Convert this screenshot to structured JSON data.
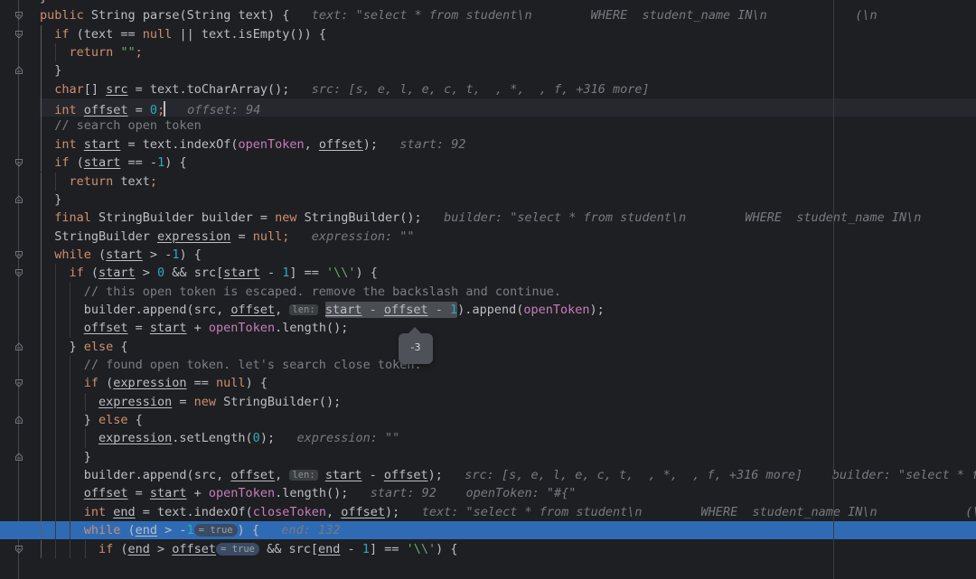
{
  "editor": {
    "file_language": "Java",
    "theme": "IntelliJ New Dark",
    "colors": {
      "background": "#1E1F22",
      "foreground": "#BCBEC4",
      "keyword": "#CF8E6D",
      "string": "#6AAB73",
      "number": "#2AACB8",
      "comment": "#7A7E85",
      "field": "#C77DBB",
      "inline_hint": "#767A80",
      "selection_line": "#2F6BB5",
      "caret_line": "#26282E",
      "tooltip_bg": "#4E5157"
    }
  },
  "tooltip": {
    "value": "-3",
    "evaluated_expression": "start - offset - 1"
  },
  "caret": {
    "line_index": 5,
    "column_text": "int offset = 0;"
  },
  "code_lines": [
    {
      "indent": 1,
      "fold": null,
      "tokens": [
        {
          "t": "}",
          "c": "sep"
        }
      ],
      "hints": [],
      "clipped_top": true
    },
    {
      "indent": 1,
      "fold": "start",
      "tokens": [
        {
          "t": "public ",
          "c": "kw"
        },
        {
          "t": "String ",
          "c": "typ"
        },
        {
          "t": "parse",
          "c": "mth"
        },
        {
          "t": "(",
          "c": "sep"
        },
        {
          "t": "String ",
          "c": "typ"
        },
        {
          "t": "text",
          "c": "var"
        },
        {
          "t": ") {",
          "c": "sep"
        }
      ],
      "hints": [
        {
          "text": "text: \"select * from student\\n        WHERE  student_name IN\\n            (\\n"
        }
      ]
    },
    {
      "indent": 2,
      "fold": "start",
      "tokens": [
        {
          "t": "if ",
          "c": "kw"
        },
        {
          "t": "(",
          "c": "sep"
        },
        {
          "t": "text",
          "c": "var"
        },
        {
          "t": " == ",
          "c": "op"
        },
        {
          "t": "null",
          "c": "kw"
        },
        {
          "t": " || ",
          "c": "op"
        },
        {
          "t": "text",
          "c": "var"
        },
        {
          "t": ".",
          "c": "sep"
        },
        {
          "t": "isEmpty",
          "c": "fn"
        },
        {
          "t": "()) {",
          "c": "sep"
        }
      ],
      "hints": []
    },
    {
      "indent": 3,
      "fold": null,
      "tokens": [
        {
          "t": "return ",
          "c": "kw"
        },
        {
          "t": "\"\"",
          "c": "str"
        },
        {
          "t": ";",
          "c": "semi"
        }
      ],
      "hints": []
    },
    {
      "indent": 2,
      "fold": "end",
      "tokens": [
        {
          "t": "}",
          "c": "sep"
        }
      ],
      "hints": []
    },
    {
      "indent": 2,
      "fold": null,
      "tokens": [
        {
          "t": "char",
          "c": "kw"
        },
        {
          "t": "[] ",
          "c": "sep"
        },
        {
          "t": "src",
          "c": "loc"
        },
        {
          "t": " = ",
          "c": "op"
        },
        {
          "t": "text",
          "c": "var"
        },
        {
          "t": ".",
          "c": "sep"
        },
        {
          "t": "toCharArray",
          "c": "fn"
        },
        {
          "t": "();",
          "c": "sep"
        }
      ],
      "hints": [
        {
          "text": "src: [s, e, l, e, c, t,  , *,  , f, +316 more]"
        }
      ]
    },
    {
      "indent": 2,
      "fold": null,
      "caret_line": true,
      "tokens": [
        {
          "t": "int ",
          "c": "kw"
        },
        {
          "t": "offset",
          "c": "loc"
        },
        {
          "t": " = ",
          "c": "op"
        },
        {
          "t": "0",
          "c": "num"
        },
        {
          "t": ";",
          "c": "semi"
        }
      ],
      "hints": [
        {
          "text": "offset: 94"
        }
      ]
    },
    {
      "indent": 2,
      "fold": null,
      "tokens": [
        {
          "t": "// search open token",
          "c": "cmt"
        }
      ],
      "hints": []
    },
    {
      "indent": 2,
      "fold": null,
      "tokens": [
        {
          "t": "int ",
          "c": "kw"
        },
        {
          "t": "start",
          "c": "loc"
        },
        {
          "t": " = ",
          "c": "op"
        },
        {
          "t": "text",
          "c": "var"
        },
        {
          "t": ".",
          "c": "sep"
        },
        {
          "t": "indexOf",
          "c": "fn"
        },
        {
          "t": "(",
          "c": "sep"
        },
        {
          "t": "openToken",
          "c": "fld"
        },
        {
          "t": ", ",
          "c": "sep"
        },
        {
          "t": "offset",
          "c": "loc"
        },
        {
          "t": ");",
          "c": "sep"
        }
      ],
      "hints": [
        {
          "text": "start: 92"
        }
      ]
    },
    {
      "indent": 2,
      "fold": "start",
      "tokens": [
        {
          "t": "if ",
          "c": "kw"
        },
        {
          "t": "(",
          "c": "sep"
        },
        {
          "t": "start",
          "c": "loc"
        },
        {
          "t": " == ",
          "c": "op"
        },
        {
          "t": "-",
          "c": "op"
        },
        {
          "t": "1",
          "c": "num"
        },
        {
          "t": ") {",
          "c": "sep"
        }
      ],
      "hints": []
    },
    {
      "indent": 3,
      "fold": null,
      "tokens": [
        {
          "t": "return ",
          "c": "kw"
        },
        {
          "t": "text",
          "c": "var"
        },
        {
          "t": ";",
          "c": "semi"
        }
      ],
      "hints": []
    },
    {
      "indent": 2,
      "fold": "end",
      "tokens": [
        {
          "t": "}",
          "c": "sep"
        }
      ],
      "hints": []
    },
    {
      "indent": 2,
      "fold": null,
      "tokens": [
        {
          "t": "final ",
          "c": "kw"
        },
        {
          "t": "StringBuilder ",
          "c": "typ"
        },
        {
          "t": "builder",
          "c": "var"
        },
        {
          "t": " = ",
          "c": "op"
        },
        {
          "t": "new ",
          "c": "kw"
        },
        {
          "t": "StringBuilder",
          "c": "typ"
        },
        {
          "t": "();",
          "c": "sep"
        }
      ],
      "hints": [
        {
          "text": "builder: \"select * from student\\n        WHERE  student_name IN\\n            ("
        }
      ]
    },
    {
      "indent": 2,
      "fold": null,
      "tokens": [
        {
          "t": "StringBuilder ",
          "c": "typ"
        },
        {
          "t": "expression",
          "c": "loc"
        },
        {
          "t": " = ",
          "c": "op"
        },
        {
          "t": "null",
          "c": "kw"
        },
        {
          "t": ";",
          "c": "semi"
        }
      ],
      "hints": [
        {
          "text": "expression: \"\""
        }
      ]
    },
    {
      "indent": 2,
      "fold": "start",
      "tokens": [
        {
          "t": "while ",
          "c": "kw"
        },
        {
          "t": "(",
          "c": "sep"
        },
        {
          "t": "start",
          "c": "loc"
        },
        {
          "t": " > ",
          "c": "op"
        },
        {
          "t": "-",
          "c": "op"
        },
        {
          "t": "1",
          "c": "num"
        },
        {
          "t": ") {",
          "c": "sep"
        }
      ],
      "hints": []
    },
    {
      "indent": 3,
      "fold": "start",
      "tokens": [
        {
          "t": "if ",
          "c": "kw"
        },
        {
          "t": "(",
          "c": "sep"
        },
        {
          "t": "start",
          "c": "loc"
        },
        {
          "t": " > ",
          "c": "op"
        },
        {
          "t": "0",
          "c": "num"
        },
        {
          "t": " && ",
          "c": "op"
        },
        {
          "t": "src",
          "c": "var"
        },
        {
          "t": "[",
          "c": "sep"
        },
        {
          "t": "start",
          "c": "loc"
        },
        {
          "t": " - ",
          "c": "op"
        },
        {
          "t": "1",
          "c": "num"
        },
        {
          "t": "] == ",
          "c": "op"
        },
        {
          "t": "'\\\\'",
          "c": "str"
        },
        {
          "t": ") {",
          "c": "sep"
        }
      ],
      "hints": []
    },
    {
      "indent": 4,
      "fold": null,
      "tokens": [
        {
          "t": "// this open token is escaped. remove the backslash and continue.",
          "c": "cmt"
        }
      ],
      "hints": []
    },
    {
      "indent": 4,
      "fold": null,
      "has_param_hint": true,
      "has_eval_highlight": true,
      "tokens": [
        {
          "t": "builder",
          "c": "var"
        },
        {
          "t": ".",
          "c": "sep"
        },
        {
          "t": "append",
          "c": "fn"
        },
        {
          "t": "(",
          "c": "sep"
        },
        {
          "t": "src",
          "c": "var"
        },
        {
          "t": ", ",
          "c": "sep"
        },
        {
          "t": "offset",
          "c": "loc"
        },
        {
          "t": ", ",
          "c": "sep"
        }
      ],
      "param_hint": "len:",
      "eval_tokens": [
        {
          "t": "start",
          "c": "loc"
        },
        {
          "t": " - ",
          "c": "op"
        },
        {
          "t": "offset",
          "c": "loc"
        },
        {
          "t": " - ",
          "c": "op"
        },
        {
          "t": "1",
          "c": "num"
        }
      ],
      "tail_tokens": [
        {
          "t": ").",
          "c": "sep"
        },
        {
          "t": "append",
          "c": "fn"
        },
        {
          "t": "(",
          "c": "sep"
        },
        {
          "t": "openToken",
          "c": "fld"
        },
        {
          "t": ");",
          "c": "sep"
        }
      ],
      "hints": []
    },
    {
      "indent": 4,
      "fold": null,
      "tokens": [
        {
          "t": "offset",
          "c": "loc"
        },
        {
          "t": " = ",
          "c": "op"
        },
        {
          "t": "start",
          "c": "loc"
        },
        {
          "t": " + ",
          "c": "op"
        },
        {
          "t": "openToken",
          "c": "fld"
        },
        {
          "t": ".",
          "c": "sep"
        },
        {
          "t": "length",
          "c": "fn"
        },
        {
          "t": "();",
          "c": "sep"
        }
      ],
      "hints": []
    },
    {
      "indent": 3,
      "fold": "end",
      "tokens": [
        {
          "t": "} ",
          "c": "sep"
        },
        {
          "t": "else",
          "c": "kw"
        },
        {
          "t": " {",
          "c": "sep"
        }
      ],
      "hints": []
    },
    {
      "indent": 4,
      "fold": null,
      "tokens": [
        {
          "t": "// found open token. let's search close token.",
          "c": "cmt"
        }
      ],
      "hints": []
    },
    {
      "indent": 4,
      "fold": "start",
      "tokens": [
        {
          "t": "if ",
          "c": "kw"
        },
        {
          "t": "(",
          "c": "sep"
        },
        {
          "t": "expression",
          "c": "loc"
        },
        {
          "t": " == ",
          "c": "op"
        },
        {
          "t": "null",
          "c": "kw"
        },
        {
          "t": ") {",
          "c": "sep"
        }
      ],
      "hints": []
    },
    {
      "indent": 5,
      "fold": null,
      "tokens": [
        {
          "t": "expression",
          "c": "loc"
        },
        {
          "t": " = ",
          "c": "op"
        },
        {
          "t": "new ",
          "c": "kw"
        },
        {
          "t": "StringBuilder",
          "c": "typ"
        },
        {
          "t": "();",
          "c": "sep"
        }
      ],
      "hints": []
    },
    {
      "indent": 4,
      "fold": "end",
      "tokens": [
        {
          "t": "} ",
          "c": "sep"
        },
        {
          "t": "else",
          "c": "kw"
        },
        {
          "t": " {",
          "c": "sep"
        }
      ],
      "hints": []
    },
    {
      "indent": 5,
      "fold": null,
      "tokens": [
        {
          "t": "expression",
          "c": "loc"
        },
        {
          "t": ".",
          "c": "sep"
        },
        {
          "t": "setLength",
          "c": "fn"
        },
        {
          "t": "(",
          "c": "sep"
        },
        {
          "t": "0",
          "c": "num"
        },
        {
          "t": ");",
          "c": "sep"
        }
      ],
      "hints": [
        {
          "text": "expression: \"\""
        }
      ]
    },
    {
      "indent": 4,
      "fold": "end",
      "tokens": [
        {
          "t": "}",
          "c": "sep"
        }
      ],
      "hints": []
    },
    {
      "indent": 4,
      "fold": null,
      "has_param_hint": true,
      "tokens": [
        {
          "t": "builder",
          "c": "var"
        },
        {
          "t": ".",
          "c": "sep"
        },
        {
          "t": "append",
          "c": "fn"
        },
        {
          "t": "(",
          "c": "sep"
        },
        {
          "t": "src",
          "c": "var"
        },
        {
          "t": ", ",
          "c": "sep"
        },
        {
          "t": "offset",
          "c": "loc"
        },
        {
          "t": ", ",
          "c": "sep"
        }
      ],
      "param_hint": "len:",
      "tail_tokens": [
        {
          "t": "start",
          "c": "loc"
        },
        {
          "t": " - ",
          "c": "op"
        },
        {
          "t": "offset",
          "c": "loc"
        },
        {
          "t": ");",
          "c": "sep"
        }
      ],
      "hints": [
        {
          "text": "src: [s, e, l, e, c, t,  , *,  , f, +316 more]"
        },
        {
          "text": "builder: \"select * from student\\n"
        }
      ]
    },
    {
      "indent": 4,
      "fold": null,
      "tokens": [
        {
          "t": "offset",
          "c": "loc"
        },
        {
          "t": " = ",
          "c": "op"
        },
        {
          "t": "start",
          "c": "loc"
        },
        {
          "t": " + ",
          "c": "op"
        },
        {
          "t": "openToken",
          "c": "fld"
        },
        {
          "t": ".",
          "c": "sep"
        },
        {
          "t": "length",
          "c": "fn"
        },
        {
          "t": "();",
          "c": "sep"
        }
      ],
      "hints": [
        {
          "text": "start: 92"
        },
        {
          "text": "openToken: \"#{\""
        }
      ]
    },
    {
      "indent": 4,
      "fold": null,
      "tokens": [
        {
          "t": "int ",
          "c": "kw"
        },
        {
          "t": "end",
          "c": "loc"
        },
        {
          "t": " = ",
          "c": "op"
        },
        {
          "t": "text",
          "c": "var"
        },
        {
          "t": ".",
          "c": "sep"
        },
        {
          "t": "indexOf",
          "c": "fn"
        },
        {
          "t": "(",
          "c": "sep"
        },
        {
          "t": "closeToken",
          "c": "fld"
        },
        {
          "t": ", ",
          "c": "sep"
        },
        {
          "t": "offset",
          "c": "loc"
        },
        {
          "t": ");",
          "c": "sep"
        }
      ],
      "hints": [
        {
          "text": "text: \"select * from student\\n        WHERE  student_name IN\\n            (\\n"
        }
      ]
    },
    {
      "indent": 4,
      "fold": "start",
      "selected": true,
      "has_eval_chip": true,
      "tokens": [
        {
          "t": "while ",
          "c": "kw"
        },
        {
          "t": "(",
          "c": "sep"
        },
        {
          "t": "end",
          "c": "loc"
        },
        {
          "t": " > ",
          "c": "op"
        },
        {
          "t": "-",
          "c": "op"
        },
        {
          "t": "1",
          "c": "num"
        }
      ],
      "eval_chip": "= true",
      "tail_tokens": [
        {
          "t": ") {",
          "c": "sep"
        }
      ],
      "hints": [
        {
          "text": "end: 132"
        }
      ]
    },
    {
      "indent": 5,
      "fold": "start",
      "has_eval_chip": true,
      "clipped_bottom": true,
      "tokens": [
        {
          "t": "if ",
          "c": "kw"
        },
        {
          "t": "(",
          "c": "sep"
        },
        {
          "t": "end",
          "c": "loc"
        },
        {
          "t": " > ",
          "c": "op"
        },
        {
          "t": "offset",
          "c": "loc"
        }
      ],
      "eval_chip": "= true",
      "tail_tokens": [
        {
          "t": " && ",
          "c": "op"
        },
        {
          "t": "src",
          "c": "var"
        },
        {
          "t": "[",
          "c": "sep"
        },
        {
          "t": "end",
          "c": "loc"
        },
        {
          "t": " - ",
          "c": "op"
        },
        {
          "t": "1",
          "c": "num"
        },
        {
          "t": "] == ",
          "c": "op"
        },
        {
          "t": "'\\\\'",
          "c": "str"
        },
        {
          "t": ") {",
          "c": "sep"
        }
      ],
      "hints": []
    }
  ]
}
